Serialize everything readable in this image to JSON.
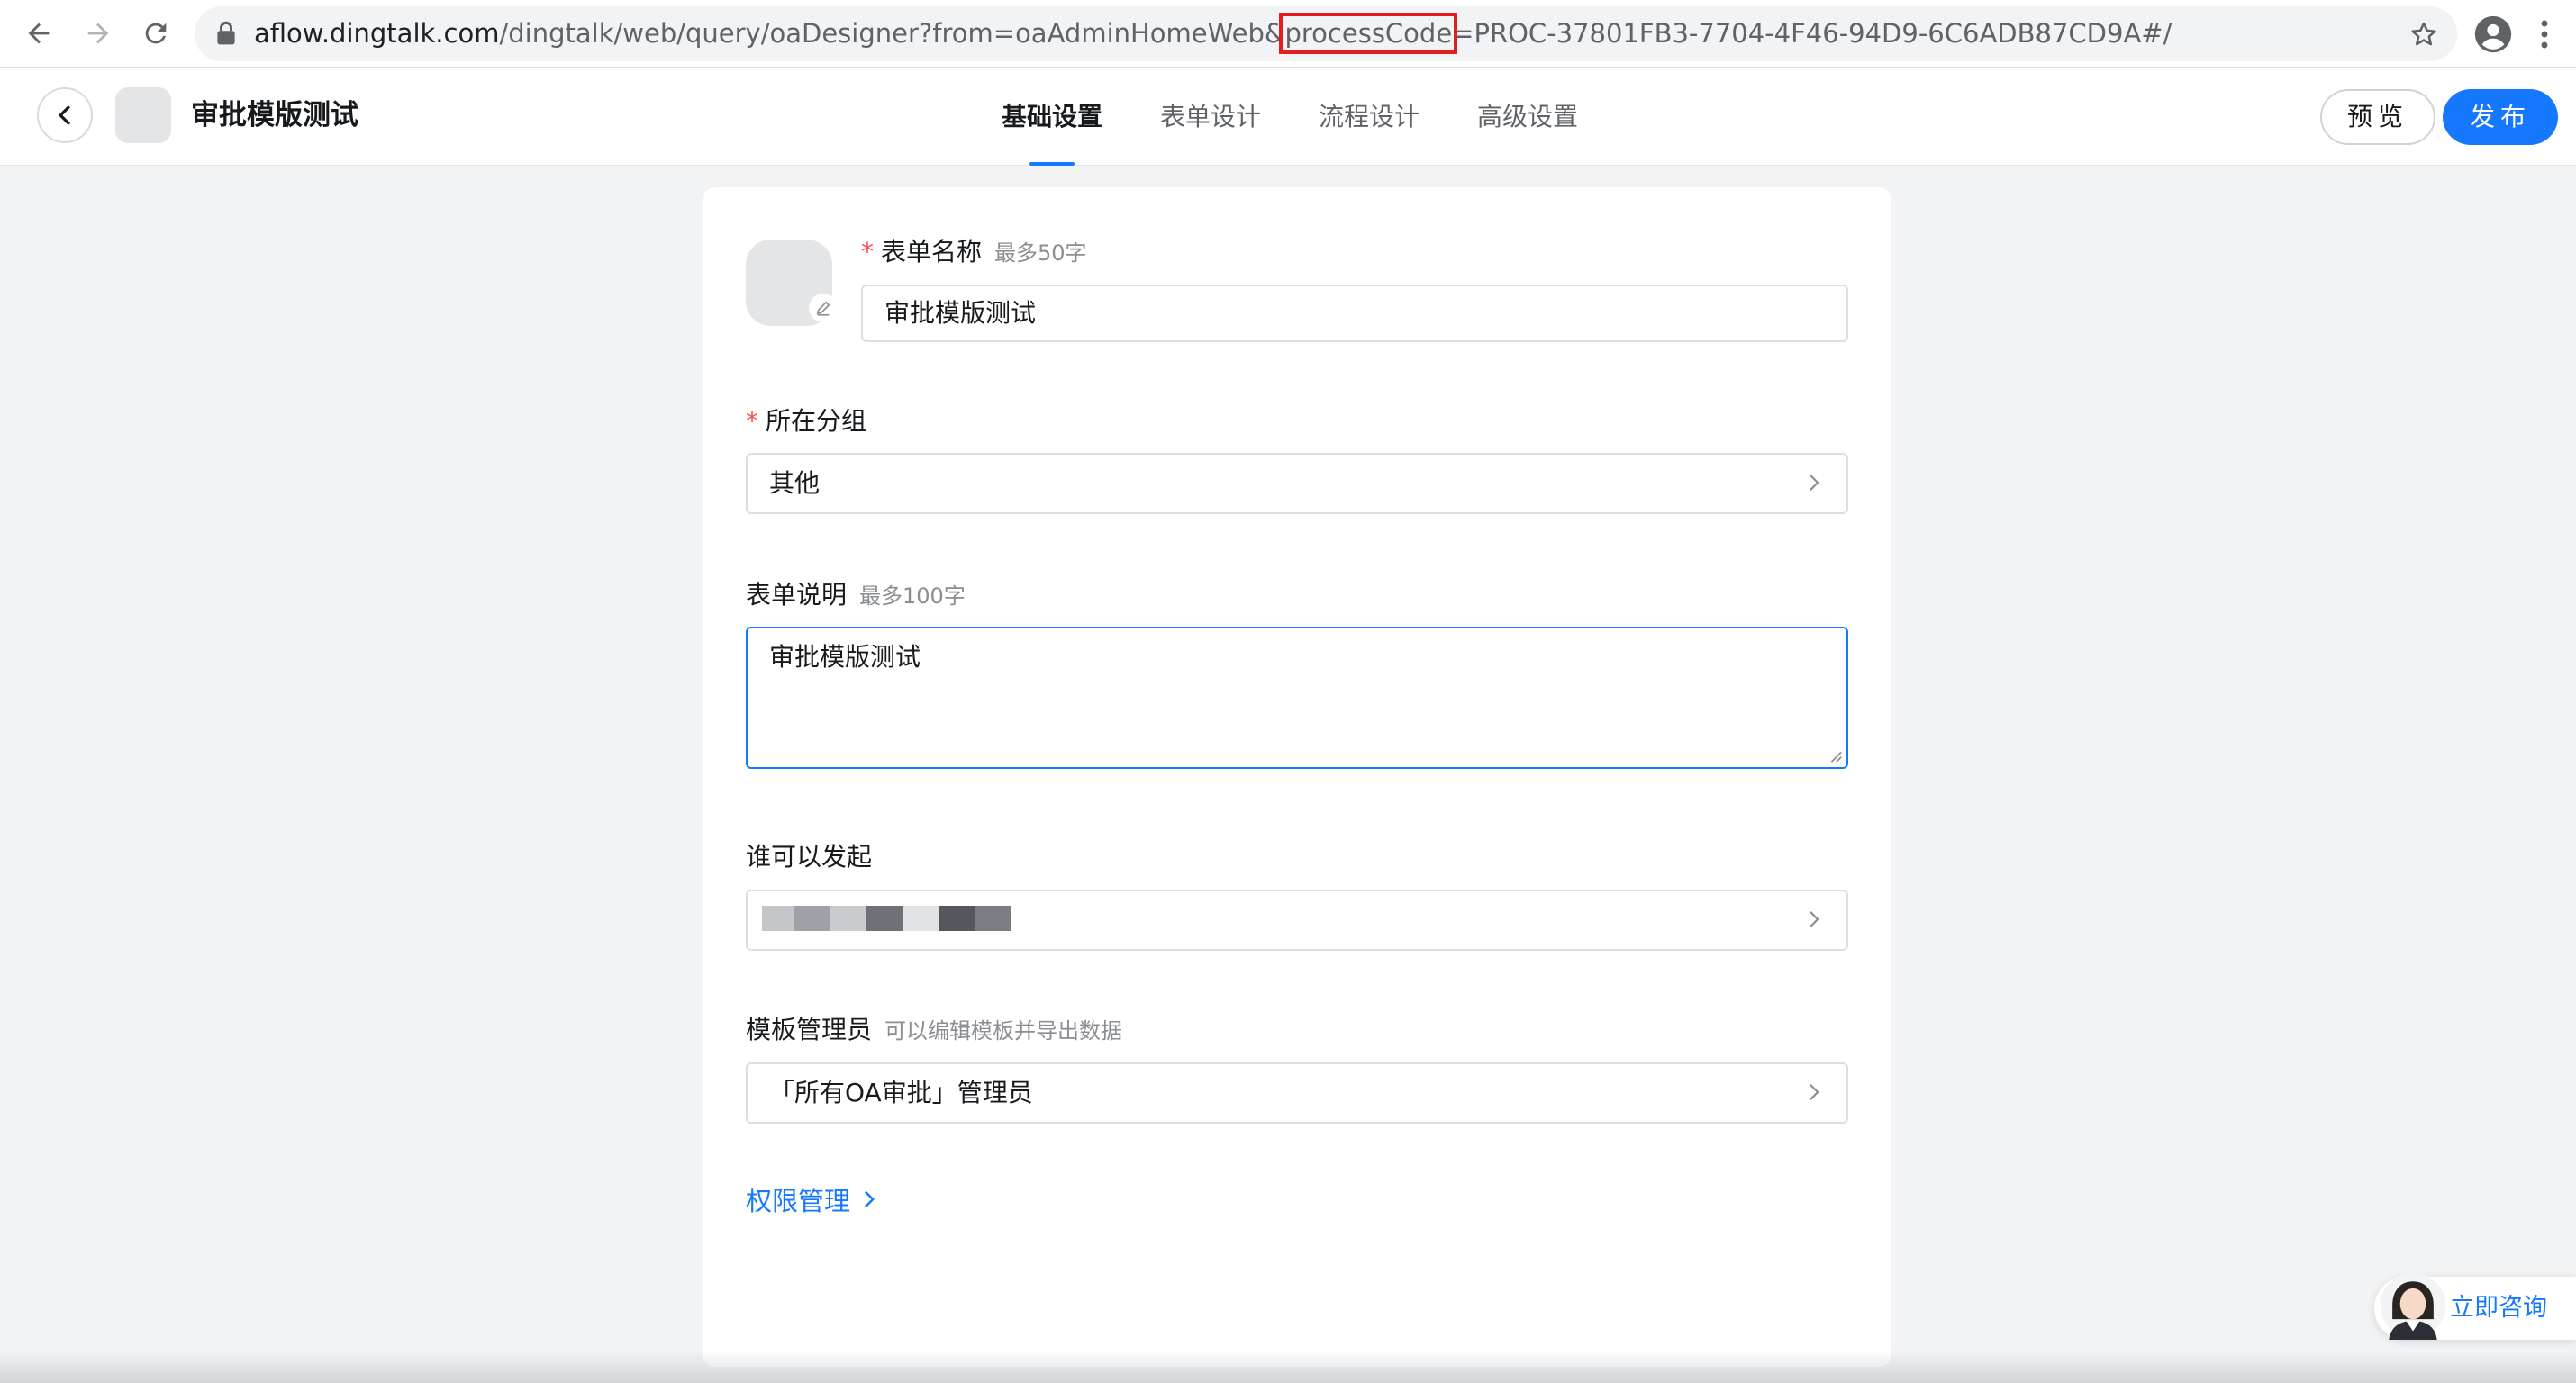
{
  "browser": {
    "url_host": "aflow.dingtalk.com",
    "url_path_before": "/dingtalk/web/query/oaDesigner?from=oaAdminHomeWeb&",
    "url_highlight": "processCode",
    "url_path_after": "=PROC-37801FB3-7704-4F46-94D9-6C6ADB87CD9A#/",
    "icons": [
      "back-arrow-icon",
      "forward-arrow-icon",
      "reload-icon",
      "lock-icon",
      "bookmark-star-icon",
      "profile-icon",
      "more-menu-icon"
    ],
    "highlight_color": "#e02020"
  },
  "header": {
    "title": "审批模版测试",
    "tabs": [
      {
        "label": "基础设置",
        "active": true
      },
      {
        "label": "表单设计",
        "active": false
      },
      {
        "label": "流程设计",
        "active": false
      },
      {
        "label": "高级设置",
        "active": false
      }
    ],
    "preview_label": "预览",
    "publish_label": "发布",
    "accent_color": "#1677ff"
  },
  "form": {
    "name": {
      "label": "表单名称",
      "hint": "最多50字",
      "value": "审批模版测试",
      "required_mark": "*"
    },
    "group": {
      "label": "所在分组",
      "value": "其他",
      "required_mark": "*"
    },
    "description": {
      "label": "表单说明",
      "hint": "最多100字",
      "value": "审批模版测试"
    },
    "initiator": {
      "label": "谁可以发起"
    },
    "admin": {
      "label": "模板管理员",
      "hint": "可以编辑模板并导出数据",
      "value": "「所有OA审批」管理员"
    },
    "permission_link": "权限管理"
  },
  "consult": {
    "label": "立即咨询"
  }
}
